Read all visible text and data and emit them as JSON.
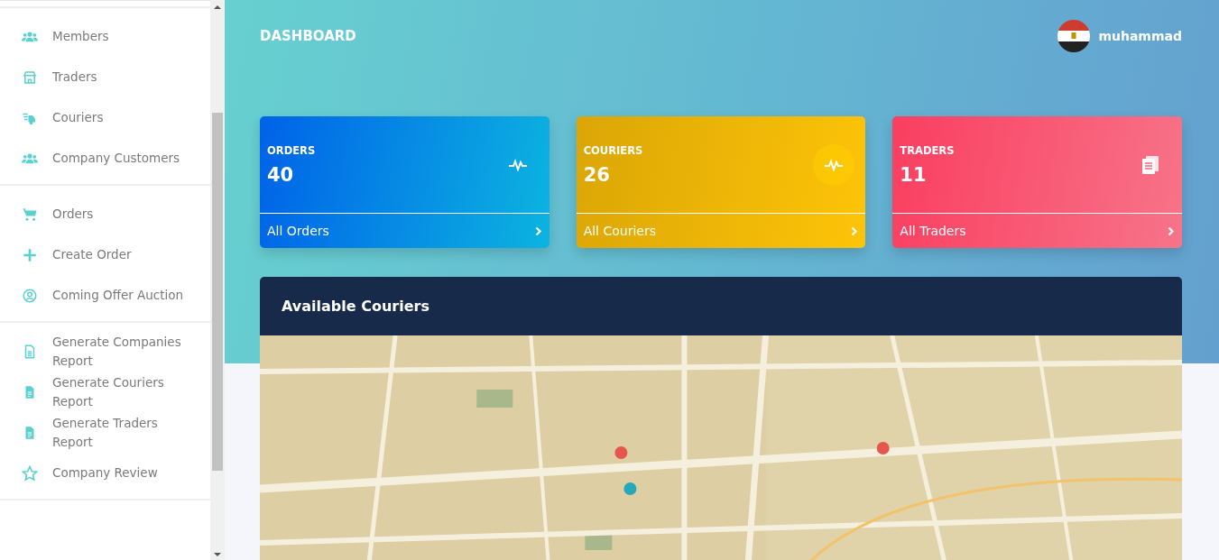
{
  "sidebar": {
    "groups": [
      {
        "items": [
          {
            "label": "Members"
          },
          {
            "label": "Traders"
          },
          {
            "label": "Couriers"
          },
          {
            "label": "Company Customers"
          }
        ]
      },
      {
        "items": [
          {
            "label": "Orders"
          },
          {
            "label": "Create Order"
          },
          {
            "label": "Coming Offer Auction"
          }
        ]
      },
      {
        "items": [
          {
            "label": "Generate Companies Report"
          },
          {
            "label": "Generate Couriers Report"
          },
          {
            "label": "Generate Traders Report"
          },
          {
            "label": "Company Review"
          }
        ]
      }
    ]
  },
  "header": {
    "title": "DASHBOARD",
    "user": "muhammad"
  },
  "stats": [
    {
      "kind": "orders",
      "title": "ORDERS",
      "count": "40",
      "link": "All Orders"
    },
    {
      "kind": "couriers",
      "title": "COURIERS",
      "count": "26",
      "link": "All Couriers"
    },
    {
      "kind": "traders",
      "title": "TRADERS",
      "count": "11",
      "link": "All Traders"
    }
  ],
  "panel": {
    "title": "Available Couriers"
  }
}
